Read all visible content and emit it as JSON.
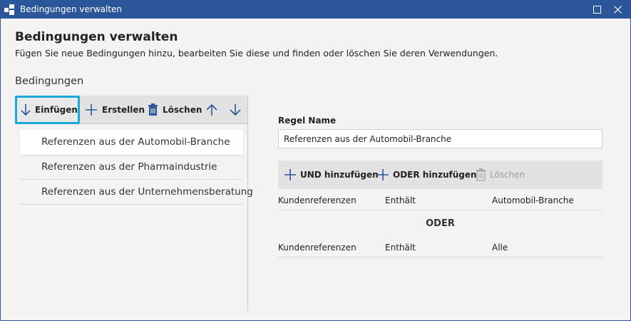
{
  "window": {
    "title": "Bedingungen verwalten"
  },
  "header": {
    "title": "Bedingungen verwalten",
    "description": "Fügen Sie neue Bedingungen hinzu, bearbeiten Sie diese und finden oder löschen Sie deren Verwendungen."
  },
  "section_label": "Bedingungen",
  "left_toolbar": {
    "insert": "Einfügen",
    "create": "Erstellen",
    "delete": "Löschen"
  },
  "conditions": [
    {
      "label": "Referenzen aus der Automobil-Branche"
    },
    {
      "label": "Referenzen aus der Pharmaindustrie"
    },
    {
      "label": "Referenzen aus der Unternehmensberatung"
    }
  ],
  "rule": {
    "name_label": "Regel Name",
    "name_value": "Referenzen aus der Automobil-Branche"
  },
  "right_toolbar": {
    "add_and": "UND hinzufügen",
    "add_or": "ODER hinzufügen",
    "delete": "Löschen"
  },
  "criteria": [
    {
      "field": "Kundenreferenzen",
      "operator": "Enthält",
      "value": "Automobil-Branche"
    },
    {
      "field": "Kundenreferenzen",
      "operator": "Enthält",
      "value": "Alle"
    }
  ],
  "or_separator": "ODER",
  "colors": {
    "titlebar": "#2b579a",
    "highlight": "#1aa8d8",
    "icon_blue": "#2b579a"
  }
}
